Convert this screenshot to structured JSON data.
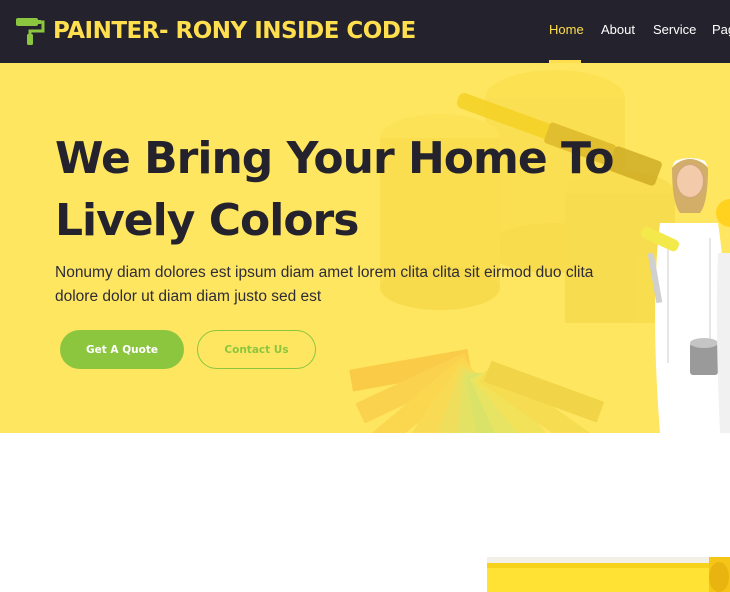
{
  "brand": {
    "name": "PAINTER- RONY INSIDE CODE",
    "icon": "paint-roller-icon"
  },
  "nav": {
    "items": [
      {
        "label": "Home",
        "active": true
      },
      {
        "label": "About",
        "active": false
      },
      {
        "label": "Service",
        "active": false
      },
      {
        "label": "Pag",
        "active": false
      }
    ]
  },
  "hero": {
    "title_line1": "We Bring Your Home To",
    "title_line2": "Lively Colors",
    "subtitle": "Nonumy diam dolores est ipsum diam amet lorem clita clita sit eirmod duo clita dolore dolor ut diam diam justo sed est",
    "primary_button": "Get A Quote",
    "secondary_button": "Contact Us"
  },
  "colors": {
    "navbar_bg": "#24232d",
    "accent_yellow": "#ffdf4e",
    "hero_bg": "#ffe660",
    "accent_green": "#8cc63f",
    "text_dark": "#24232d"
  }
}
